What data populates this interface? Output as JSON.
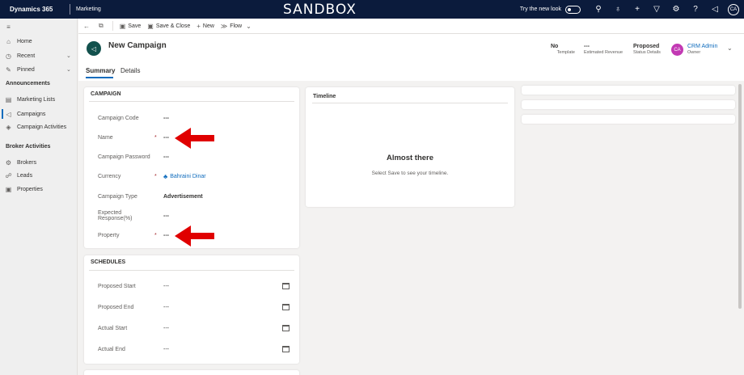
{
  "topbar": {
    "brand": "Dynamics 365",
    "app": "Marketing",
    "environment": "SANDBOX",
    "try_new_look": "Try the new look",
    "user_initials": "CA",
    "icons": [
      "search-icon",
      "lightbulb-icon",
      "plus-icon",
      "filter-icon",
      "gear-icon",
      "help-icon",
      "share-icon"
    ]
  },
  "sidebar": {
    "items": [
      {
        "label": "Home",
        "icon": "home-icon"
      },
      {
        "label": "Recent",
        "icon": "clock-icon"
      },
      {
        "label": "Pinned",
        "icon": "pin-icon"
      }
    ],
    "group1": {
      "title": "Announcements",
      "items": [
        {
          "label": "Marketing Lists",
          "icon": "list-icon"
        },
        {
          "label": "Campaigns",
          "icon": "megaphone-icon"
        },
        {
          "label": "Campaign Activities",
          "icon": "activity-icon"
        }
      ]
    },
    "group2": {
      "title": "Broker Activities",
      "items": [
        {
          "label": "Brokers",
          "icon": "broker-icon"
        },
        {
          "label": "Leads",
          "icon": "leads-icon"
        },
        {
          "label": "Properties",
          "icon": "properties-icon"
        }
      ]
    }
  },
  "commandbar": {
    "save": "Save",
    "save_close": "Save & Close",
    "new": "New",
    "flow": "Flow"
  },
  "header": {
    "title": "New Campaign",
    "fields": [
      {
        "value": "No",
        "label": "Template"
      },
      {
        "value": "---",
        "label": "Estimated Revenue"
      },
      {
        "value": "Proposed",
        "label": "Status Details"
      }
    ],
    "owner": {
      "initials": "CA",
      "name": "CRM Admin",
      "label": "Owner"
    },
    "tabs": [
      "Summary",
      "Details"
    ]
  },
  "campaign_section": {
    "title": "CAMPAIGN",
    "fields": [
      {
        "label": "Campaign Code",
        "required": "",
        "value": "---"
      },
      {
        "label": "Name",
        "required": "*",
        "value": "---"
      },
      {
        "label": "Campaign Password",
        "required": "",
        "value": "---"
      },
      {
        "label": "Currency",
        "required": "*",
        "value": "Bahraini Dinar"
      },
      {
        "label": "Campaign Type",
        "required": "",
        "value": "Advertisement"
      },
      {
        "label": "Expected Response(%)",
        "required": "",
        "value": "---"
      },
      {
        "label": "Property",
        "required": "*",
        "value": "---"
      }
    ]
  },
  "schedules_section": {
    "title": "SCHEDULES",
    "fields": [
      {
        "label": "Proposed Start",
        "value": "---"
      },
      {
        "label": "Proposed End",
        "value": "---"
      },
      {
        "label": "Actual Start",
        "value": "---"
      },
      {
        "label": "Actual End",
        "value": "---"
      }
    ]
  },
  "timeline": {
    "title": "Timeline",
    "heading": "Almost there",
    "message": "Select Save to see your timeline."
  },
  "colors": {
    "topbar": "#0b1b3c",
    "accent": "#0f6cbd",
    "arrow": "#e00000",
    "record_icon": "#12514d",
    "owner_avatar": "#c239b3"
  }
}
